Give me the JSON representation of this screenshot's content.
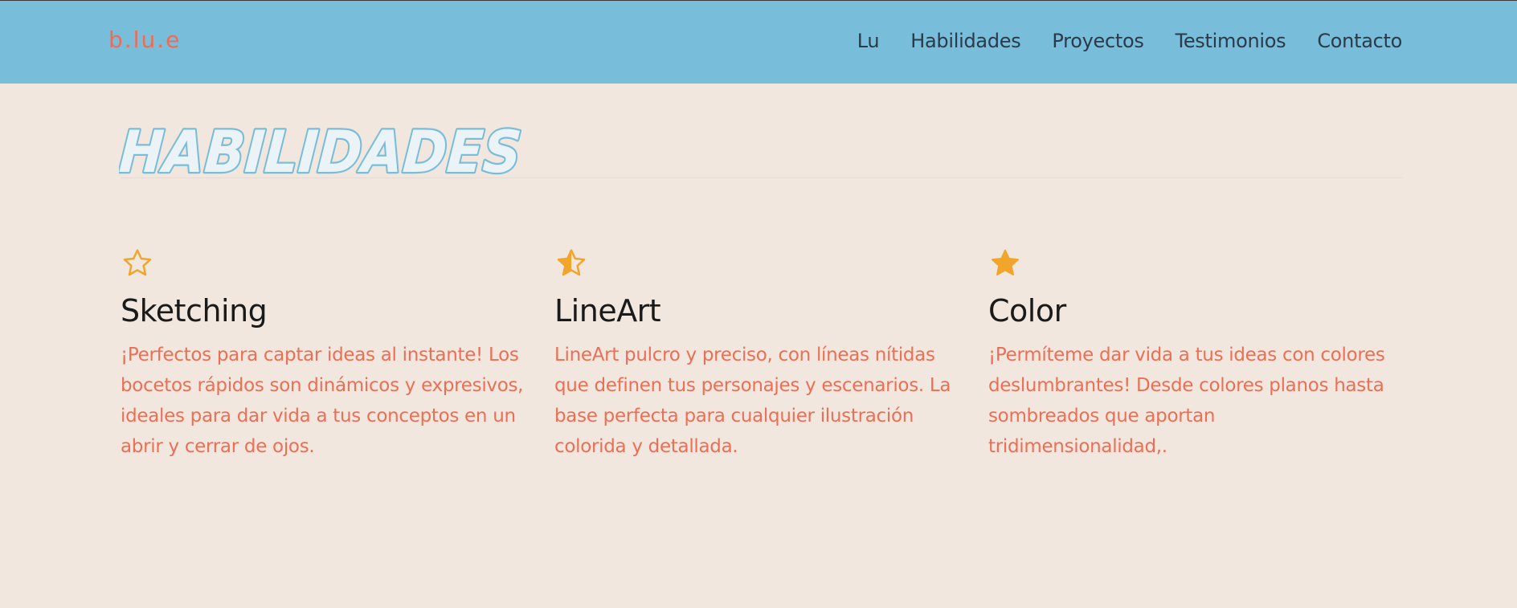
{
  "brand": {
    "logo_text": "b.lu.e"
  },
  "nav": {
    "items": [
      {
        "label": "Lu"
      },
      {
        "label": "Habilidades"
      },
      {
        "label": "Proyectos"
      },
      {
        "label": "Testimonios"
      },
      {
        "label": "Contacto"
      }
    ]
  },
  "section": {
    "title": "HABILIDADES"
  },
  "skills": [
    {
      "icon": "star-outline-icon",
      "title": "Sketching",
      "description": "¡Perfectos para captar ideas al instante! Los bocetos rápidos son dinámicos y expresivos, ideales para dar vida a tus conceptos en un abrir y cerrar de ojos."
    },
    {
      "icon": "star-half-icon",
      "title": "LineArt",
      "description": "LineArt pulcro y preciso, con líneas nítidas que definen tus personajes y escenarios. La base perfecta para cualquier ilustración colorida y detallada."
    },
    {
      "icon": "star-full-icon",
      "title": "Color",
      "description": "¡Permíteme dar vida a tus ideas con colores deslumbrantes! Desde colores planos hasta sombreados que aportan tridimensionalidad,."
    }
  ],
  "colors": {
    "header_bg": "#78bdd9",
    "page_bg": "#f1e7de",
    "accent_coral": "#ec6f55",
    "star_gold": "#f2a52b",
    "title_outline": "#78bdd9"
  }
}
